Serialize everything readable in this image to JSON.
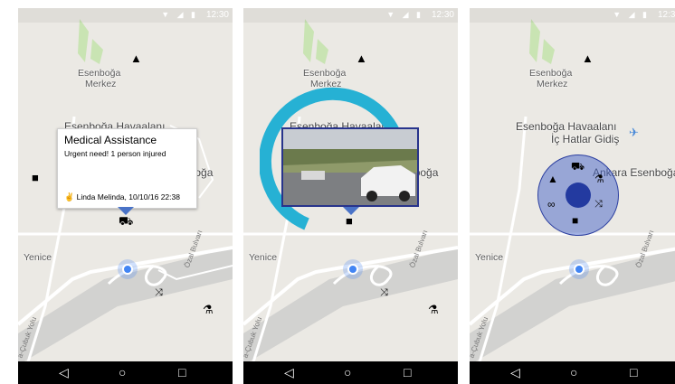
{
  "status": {
    "time": "12:30",
    "icons": "▼ ◢ ▮"
  },
  "nav": {
    "back": "◁",
    "home": "○",
    "recents": "□"
  },
  "map_labels": {
    "esenboga": "Esenboğa",
    "merkez": "Merkez",
    "havaalani": "Esenboğa Havaalanı",
    "ic_hatlar": "İç Hatlar Gidiş",
    "ankara": "Ankara Esenboğa",
    "yenice": "Yenice",
    "ozal": "Özal Bulvarı",
    "cubuk": "a-Çubuk Yolu"
  },
  "popup": {
    "title": "Medical Assistance",
    "body": "Urgent need! 1 person injured",
    "author": "Linda Melinda, 10/10/16 22:38"
  },
  "colors": {
    "ring": "#26b1d4",
    "radial_fill": "#5b73c8",
    "radial_center": "#233aa0",
    "location": "#4285f4",
    "pin": "#4a73c7"
  },
  "icons": [
    "warning-icon",
    "camera-icon",
    "ambulance-icon",
    "binoculars-icon",
    "flask-icon",
    "collapse-arrows-icon",
    "airplane-icon"
  ]
}
